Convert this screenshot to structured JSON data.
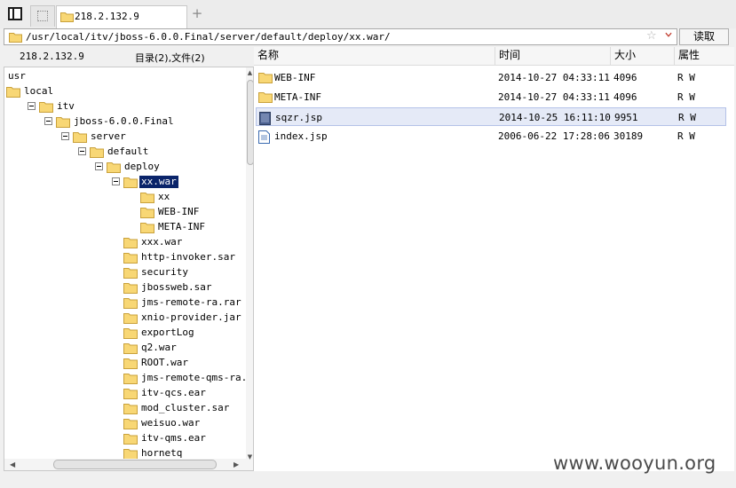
{
  "tabs": [
    {
      "label": "218.2.132.9",
      "active": true
    }
  ],
  "new_tab_symbol": "+",
  "pathbar": {
    "path": "/usr/local/itv/jboss-6.0.0.Final/server/default/deploy/xx.war/",
    "bookmark_symbol": "☆",
    "read_label": "读取"
  },
  "left_header": {
    "host": "218.2.132.9",
    "summary": "目录(2),文件(2)"
  },
  "tree": [
    {
      "label": "usr",
      "level": 0,
      "toggle": false,
      "folder": false
    },
    {
      "label": "local",
      "level": 0,
      "toggle": false,
      "folder": true
    },
    {
      "label": "itv",
      "level": 1,
      "toggle": true,
      "folder": true
    },
    {
      "label": "jboss-6.0.0.Final",
      "level": 2,
      "toggle": true,
      "folder": true
    },
    {
      "label": "server",
      "level": 3,
      "toggle": true,
      "folder": true
    },
    {
      "label": "default",
      "level": 4,
      "toggle": true,
      "folder": true
    },
    {
      "label": "deploy",
      "level": 5,
      "toggle": true,
      "folder": true
    },
    {
      "label": "xx.war",
      "level": 6,
      "toggle": true,
      "folder": true,
      "selected": true
    },
    {
      "label": "xx",
      "level": 7,
      "toggle": false,
      "folder": true
    },
    {
      "label": "WEB-INF",
      "level": 7,
      "toggle": false,
      "folder": true
    },
    {
      "label": "META-INF",
      "level": 7,
      "toggle": false,
      "folder": true
    },
    {
      "label": "xxx.war",
      "level": 6,
      "toggle": false,
      "folder": true
    },
    {
      "label": "http-invoker.sar",
      "level": 6,
      "toggle": false,
      "folder": true
    },
    {
      "label": "security",
      "level": 6,
      "toggle": false,
      "folder": true
    },
    {
      "label": "jbossweb.sar",
      "level": 6,
      "toggle": false,
      "folder": true
    },
    {
      "label": "jms-remote-ra.rar",
      "level": 6,
      "toggle": false,
      "folder": true
    },
    {
      "label": "xnio-provider.jar",
      "level": 6,
      "toggle": false,
      "folder": true
    },
    {
      "label": "exportLog",
      "level": 6,
      "toggle": false,
      "folder": true
    },
    {
      "label": "q2.war",
      "level": 6,
      "toggle": false,
      "folder": true
    },
    {
      "label": "ROOT.war",
      "level": 6,
      "toggle": false,
      "folder": true
    },
    {
      "label": "jms-remote-qms-ra.rar",
      "level": 6,
      "toggle": false,
      "folder": true
    },
    {
      "label": "itv-qcs.ear",
      "level": 6,
      "toggle": false,
      "folder": true
    },
    {
      "label": "mod_cluster.sar",
      "level": 6,
      "toggle": false,
      "folder": true
    },
    {
      "label": "weisuo.war",
      "level": 6,
      "toggle": false,
      "folder": true
    },
    {
      "label": "itv-qms.ear",
      "level": 6,
      "toggle": false,
      "folder": true
    },
    {
      "label": "hornetq",
      "level": 6,
      "toggle": false,
      "folder": true
    }
  ],
  "columns": {
    "name": "名称",
    "time": "时间",
    "size": "大小",
    "attr": "属性"
  },
  "files": [
    {
      "name": "WEB-INF",
      "time": "2014-10-27 04:33:11",
      "size": "4096",
      "attr": "R W",
      "type": "folder"
    },
    {
      "name": "META-INF",
      "time": "2014-10-27 04:33:11",
      "size": "4096",
      "attr": "R W",
      "type": "folder"
    },
    {
      "name": "sqzr.jsp",
      "time": "2014-10-25 16:11:10",
      "size": "9951",
      "attr": "R W",
      "type": "jsp",
      "selected": true
    },
    {
      "name": "index.jsp",
      "time": "2006-06-22 17:28:06",
      "size": "30189",
      "attr": "R W",
      "type": "file"
    }
  ],
  "watermark": "www.wooyun.org",
  "colors": {
    "folder_fill": "#f8d775",
    "folder_stroke": "#c9a13b",
    "selection": "#0a246a",
    "row_selected": "#e5eaf7"
  }
}
